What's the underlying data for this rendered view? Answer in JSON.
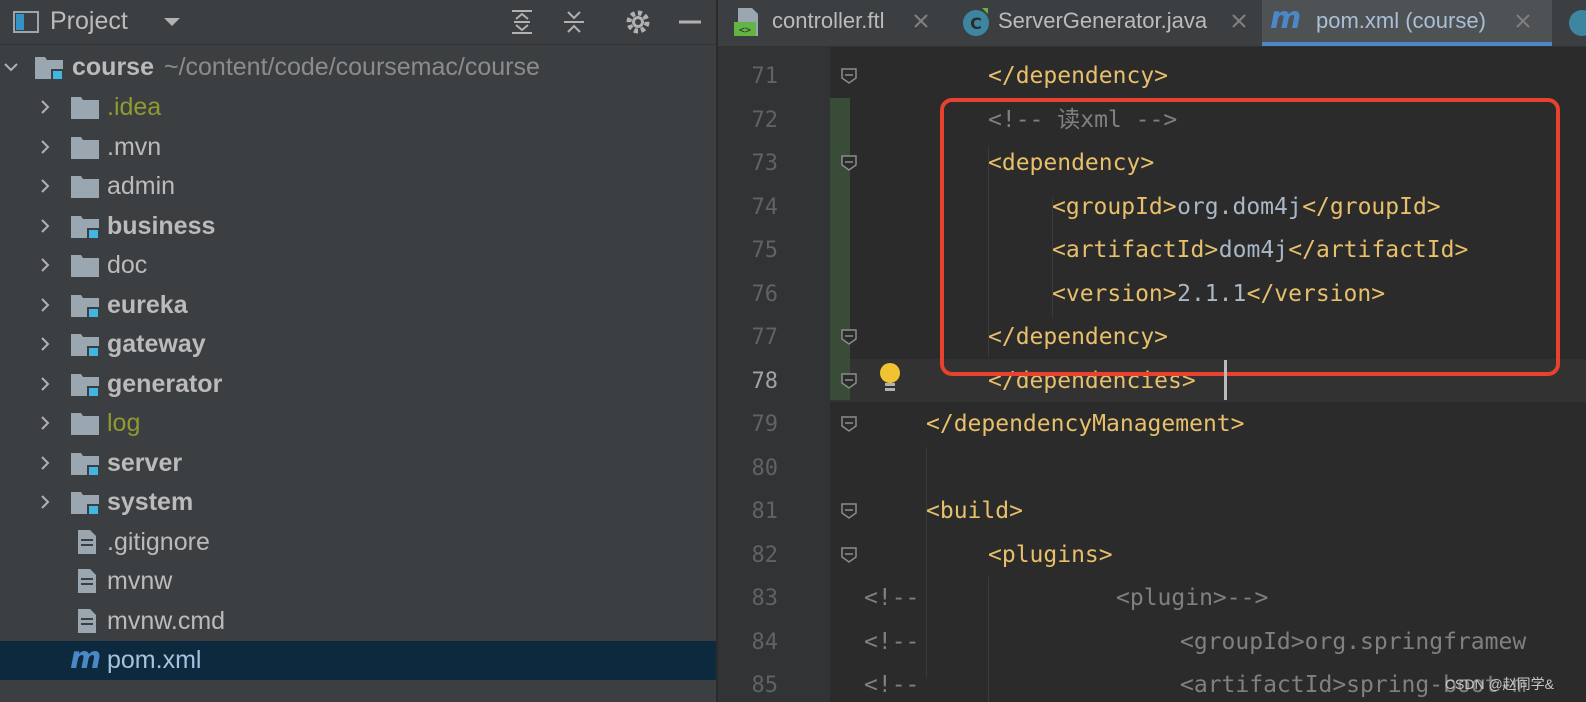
{
  "project_panel": {
    "title": "Project",
    "root": {
      "name": "course",
      "path": "~/content/code/coursemac/course"
    },
    "items": [
      {
        "label": ".idea",
        "type": "folder",
        "ignored": true,
        "expandable": true
      },
      {
        "label": ".mvn",
        "type": "folder",
        "expandable": true
      },
      {
        "label": "admin",
        "type": "folder",
        "expandable": true
      },
      {
        "label": "business",
        "type": "module",
        "expandable": true
      },
      {
        "label": "doc",
        "type": "folder",
        "expandable": true
      },
      {
        "label": "eureka",
        "type": "module",
        "expandable": true
      },
      {
        "label": "gateway",
        "type": "module",
        "expandable": true
      },
      {
        "label": "generator",
        "type": "module",
        "expandable": true
      },
      {
        "label": "log",
        "type": "folder",
        "ignored": true,
        "expandable": true
      },
      {
        "label": "server",
        "type": "module",
        "expandable": true
      },
      {
        "label": "system",
        "type": "module",
        "expandable": true
      },
      {
        "label": ".gitignore",
        "type": "file"
      },
      {
        "label": "mvnw",
        "type": "file"
      },
      {
        "label": "mvnw.cmd",
        "type": "file"
      },
      {
        "label": "pom.xml",
        "type": "maven",
        "selected": true
      }
    ]
  },
  "tabs": [
    {
      "label": "controller.ftl",
      "icon": "ftl-file-icon"
    },
    {
      "label": "ServerGenerator.java",
      "icon": "java-class-icon"
    },
    {
      "label": "pom.xml (course)",
      "icon": "maven-icon",
      "active": true
    }
  ],
  "editor": {
    "current_line": "78",
    "lines": [
      {
        "num": "71",
        "segments": [
          {
            "t": "</dependency>",
            "c": "tag"
          }
        ]
      },
      {
        "num": "72",
        "segments": [
          {
            "t": "<!-- 读xml -->",
            "c": "cmt"
          }
        ]
      },
      {
        "num": "73",
        "segments": [
          {
            "t": "<dependency>",
            "c": "tag"
          }
        ]
      },
      {
        "num": "74",
        "segments": [
          {
            "t": "<groupId>",
            "c": "tag"
          },
          {
            "t": "org.dom4j",
            "c": "txt"
          },
          {
            "t": "</groupId>",
            "c": "tag"
          }
        ]
      },
      {
        "num": "75",
        "segments": [
          {
            "t": "<artifactId>",
            "c": "tag"
          },
          {
            "t": "dom4j",
            "c": "txt"
          },
          {
            "t": "</artifactId>",
            "c": "tag"
          }
        ]
      },
      {
        "num": "76",
        "segments": [
          {
            "t": "<version>",
            "c": "tag"
          },
          {
            "t": "2.1.1",
            "c": "txt"
          },
          {
            "t": "</version>",
            "c": "tag"
          }
        ]
      },
      {
        "num": "77",
        "segments": [
          {
            "t": "</dependency>",
            "c": "tag"
          }
        ]
      },
      {
        "num": "78",
        "segments": [
          {
            "t": "</dependencies>",
            "c": "tag"
          }
        ]
      },
      {
        "num": "79",
        "segments": [
          {
            "t": "</dependencyManagement>",
            "c": "tag"
          }
        ]
      },
      {
        "num": "80",
        "segments": []
      },
      {
        "num": "81",
        "segments": [
          {
            "t": "<build>",
            "c": "tag"
          }
        ]
      },
      {
        "num": "82",
        "segments": [
          {
            "t": "<plugins>",
            "c": "tag"
          }
        ]
      },
      {
        "num": "83",
        "segments": [
          {
            "t": "<!--",
            "c": "cmt"
          },
          {
            "t": "<plugin>-->",
            "c": "cmt"
          }
        ]
      },
      {
        "num": "84",
        "segments": [
          {
            "t": "<!--",
            "c": "cmt"
          },
          {
            "t": "<groupId>org.springframew",
            "c": "cmt"
          }
        ]
      },
      {
        "num": "85",
        "segments": [
          {
            "t": "<!--",
            "c": "cmt"
          },
          {
            "t": "<artifactId>spring-boot-m",
            "c": "cmt"
          }
        ]
      }
    ]
  },
  "watermark": "CSDN @赵同学&",
  "colors": {
    "tag": "#e8bf6a",
    "text": "#a9b7c6",
    "comment": "#808080",
    "highlight_box": "#e8412e",
    "accent": "#4a88c7"
  }
}
